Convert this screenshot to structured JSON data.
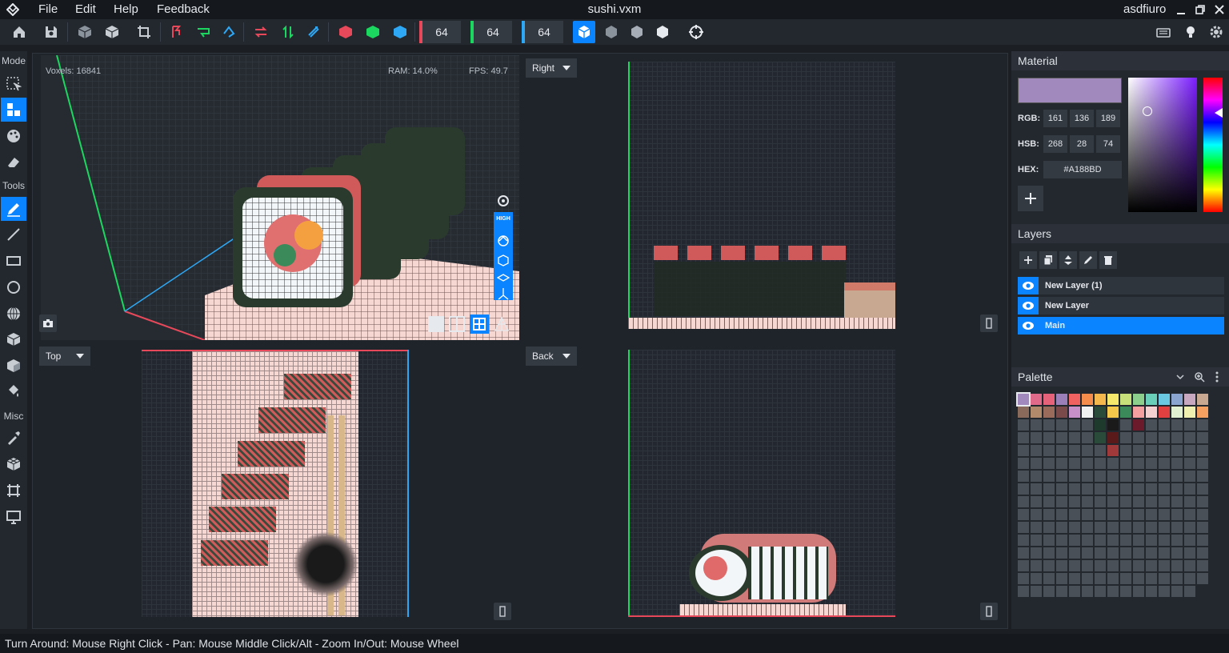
{
  "menubar": {
    "items": [
      "File",
      "Edit",
      "Help",
      "Feedback"
    ],
    "title": "sushi.vxm",
    "user": "asdfiuro"
  },
  "toolbar": {
    "size_x": "64",
    "size_y": "64",
    "size_z": "64",
    "axis_colors": [
      "#e8495a",
      "#1bd760",
      "#2ea8f5"
    ]
  },
  "sidebar": {
    "sections": [
      "Mode",
      "Tools",
      "Misc"
    ],
    "mode_items": [
      "select",
      "voxel-mode",
      "paint",
      "erase"
    ],
    "tool_items": [
      "pencil",
      "line",
      "rectangle",
      "circle",
      "sphere",
      "cube",
      "box",
      "fill"
    ],
    "misc_items": [
      "eyedropper",
      "voxel-cube",
      "crop",
      "screen"
    ]
  },
  "viewport": {
    "perspective": {
      "voxels": "Voxels: 16841",
      "ram": "RAM: 14.0%",
      "fps": "FPS: 49.7",
      "quality": "HIGH"
    },
    "views": {
      "right": "Right",
      "top": "Top",
      "back": "Back"
    }
  },
  "material": {
    "title": "Material",
    "color_hex": "#A188BD",
    "rgb_label": "RGB:",
    "rgb": [
      "161",
      "136",
      "189"
    ],
    "hsb_label": "HSB:",
    "hsb": [
      "268",
      "28",
      "74"
    ],
    "hex_label": "HEX:",
    "hex": "#A188BD"
  },
  "layers": {
    "title": "Layers",
    "items": [
      {
        "name": "New Layer (1)",
        "selected": false
      },
      {
        "name": "New Layer",
        "selected": false
      },
      {
        "name": "Main",
        "selected": true
      }
    ]
  },
  "palette": {
    "title": "Palette",
    "row1": [
      "#a188bd",
      "#e06a8a",
      "#e6627a",
      "#9a7fb8",
      "#f06262",
      "#f58c4c",
      "#f5b84c",
      "#f5e86a",
      "#c8e07a",
      "#8ccf8c",
      "#6acfb8",
      "#6ac8e0",
      "#8aa6d0",
      "#c8a8c0",
      "#c8a890"
    ],
    "row2": [
      "#8a6a5a",
      "#b08a6a",
      "#9a6a5a",
      "#7a4a4a",
      "#c890c8",
      "#f0f0f0",
      "#2a4a3a",
      "#f5c84c",
      "#3a8a5a",
      "#f5a0a0",
      "#f5d0d0",
      "#e04040",
      "#e0f0d0",
      "#f0f0b0",
      "#f5a060"
    ],
    "extra": [
      {
        "col": 6,
        "row": 2,
        "color": "#1e3a2c"
      },
      {
        "col": 7,
        "row": 2,
        "color": "#1a1a1a"
      },
      {
        "col": 9,
        "row": 2,
        "color": "#6a1a2a"
      },
      {
        "col": 6,
        "row": 3,
        "color": "#2a4a3a"
      },
      {
        "col": 7,
        "row": 3,
        "color": "#5a1a1a"
      },
      {
        "col": 7,
        "row": 4,
        "color": "#a03a3a"
      }
    ]
  },
  "status": {
    "hint": "Turn Around: Mouse Right Click - Pan: Mouse Middle Click/Alt - Zoom In/Out: Mouse Wheel"
  }
}
